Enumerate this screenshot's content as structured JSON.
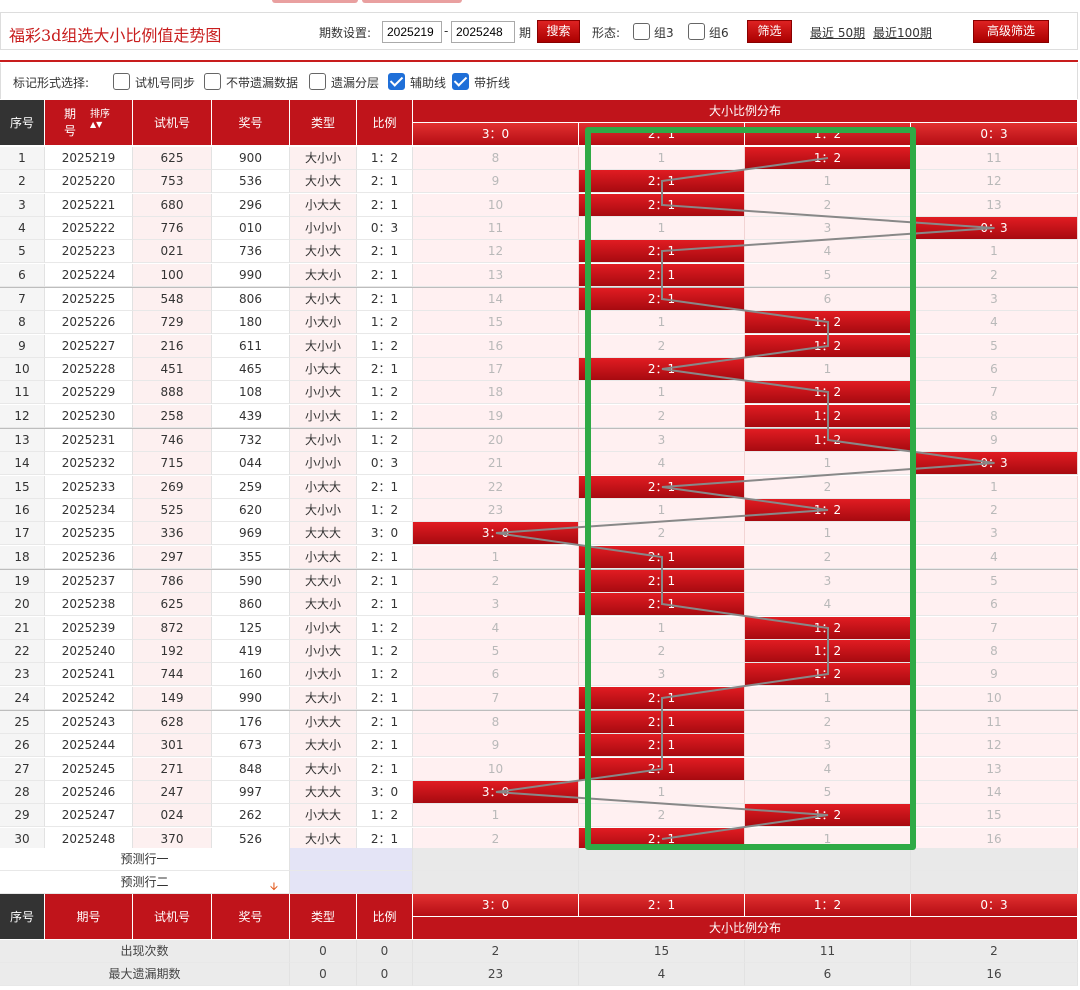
{
  "title": "福彩3d组选大小比例值走势图",
  "controls": {
    "period_label": "期数设置:",
    "from": "2025219",
    "to": "2025248",
    "period_suffix": "期",
    "search": "搜索",
    "form_label": "形态:",
    "zu3": "组3",
    "zu6": "组6",
    "filter": "筛选",
    "recent50": "最近 50期",
    "recent100": "最近100期",
    "advanced": "高级筛选"
  },
  "options": {
    "label": "标记形式选择:",
    "items": [
      {
        "label": "试机号同步",
        "checked": false
      },
      {
        "label": "不带遗漏数据",
        "checked": false
      },
      {
        "label": "遗漏分层",
        "checked": false
      },
      {
        "label": "辅助线",
        "checked": true
      },
      {
        "label": "带折线",
        "checked": true
      }
    ]
  },
  "headers": {
    "seq": "序号",
    "issue": "期号",
    "sort": "排序",
    "trial": "试机号",
    "draw": "奖号",
    "type": "类型",
    "ratio": "比例",
    "dist": "大小比例分布",
    "cols": [
      "3：0",
      "2：1",
      "1：2",
      "0：3"
    ]
  },
  "rows": [
    {
      "seq": "1",
      "issue": "2025219",
      "trial": "625",
      "draw": "900",
      "type": "大小小",
      "ratio": "1：2",
      "hit": 2,
      "vals": [
        "8",
        "1",
        "1：2",
        "11"
      ]
    },
    {
      "seq": "2",
      "issue": "2025220",
      "trial": "753",
      "draw": "536",
      "type": "大小大",
      "ratio": "2：1",
      "hit": 1,
      "vals": [
        "9",
        "2：1",
        "1",
        "12"
      ]
    },
    {
      "seq": "3",
      "issue": "2025221",
      "trial": "680",
      "draw": "296",
      "type": "小大大",
      "ratio": "2：1",
      "hit": 1,
      "vals": [
        "10",
        "2：1",
        "2",
        "13"
      ]
    },
    {
      "seq": "4",
      "issue": "2025222",
      "trial": "776",
      "draw": "010",
      "type": "小小小",
      "ratio": "0：3",
      "hit": 3,
      "vals": [
        "11",
        "1",
        "3",
        "0：3"
      ]
    },
    {
      "seq": "5",
      "issue": "2025223",
      "trial": "021",
      "draw": "736",
      "type": "大小大",
      "ratio": "2：1",
      "hit": 1,
      "vals": [
        "12",
        "2：1",
        "4",
        "1"
      ]
    },
    {
      "seq": "6",
      "issue": "2025224",
      "trial": "100",
      "draw": "990",
      "type": "大大小",
      "ratio": "2：1",
      "hit": 1,
      "vals": [
        "13",
        "2：1",
        "5",
        "2"
      ]
    },
    {
      "seq": "7",
      "issue": "2025225",
      "trial": "548",
      "draw": "806",
      "type": "大小大",
      "ratio": "2：1",
      "hit": 1,
      "vals": [
        "14",
        "2：1",
        "6",
        "3"
      ]
    },
    {
      "seq": "8",
      "issue": "2025226",
      "trial": "729",
      "draw": "180",
      "type": "小大小",
      "ratio": "1：2",
      "hit": 2,
      "vals": [
        "15",
        "1",
        "1：2",
        "4"
      ]
    },
    {
      "seq": "9",
      "issue": "2025227",
      "trial": "216",
      "draw": "611",
      "type": "大小小",
      "ratio": "1：2",
      "hit": 2,
      "vals": [
        "16",
        "2",
        "1：2",
        "5"
      ]
    },
    {
      "seq": "10",
      "issue": "2025228",
      "trial": "451",
      "draw": "465",
      "type": "小大大",
      "ratio": "2：1",
      "hit": 1,
      "vals": [
        "17",
        "2：1",
        "1",
        "6"
      ]
    },
    {
      "seq": "11",
      "issue": "2025229",
      "trial": "888",
      "draw": "108",
      "type": "小小大",
      "ratio": "1：2",
      "hit": 2,
      "vals": [
        "18",
        "1",
        "1：2",
        "7"
      ]
    },
    {
      "seq": "12",
      "issue": "2025230",
      "trial": "258",
      "draw": "439",
      "type": "小小大",
      "ratio": "1：2",
      "hit": 2,
      "vals": [
        "19",
        "2",
        "1：2",
        "8"
      ]
    },
    {
      "seq": "13",
      "issue": "2025231",
      "trial": "746",
      "draw": "732",
      "type": "大小小",
      "ratio": "1：2",
      "hit": 2,
      "vals": [
        "20",
        "3",
        "1：2",
        "9"
      ]
    },
    {
      "seq": "14",
      "issue": "2025232",
      "trial": "715",
      "draw": "044",
      "type": "小小小",
      "ratio": "0：3",
      "hit": 3,
      "vals": [
        "21",
        "4",
        "1",
        "0：3"
      ]
    },
    {
      "seq": "15",
      "issue": "2025233",
      "trial": "269",
      "draw": "259",
      "type": "小大大",
      "ratio": "2：1",
      "hit": 1,
      "vals": [
        "22",
        "2：1",
        "2",
        "1"
      ]
    },
    {
      "seq": "16",
      "issue": "2025234",
      "trial": "525",
      "draw": "620",
      "type": "大小小",
      "ratio": "1：2",
      "hit": 2,
      "vals": [
        "23",
        "1",
        "1：2",
        "2"
      ]
    },
    {
      "seq": "17",
      "issue": "2025235",
      "trial": "336",
      "draw": "969",
      "type": "大大大",
      "ratio": "3：0",
      "hit": 0,
      "vals": [
        "3：0",
        "2",
        "1",
        "3"
      ]
    },
    {
      "seq": "18",
      "issue": "2025236",
      "trial": "297",
      "draw": "355",
      "type": "小大大",
      "ratio": "2：1",
      "hit": 1,
      "vals": [
        "1",
        "2：1",
        "2",
        "4"
      ]
    },
    {
      "seq": "19",
      "issue": "2025237",
      "trial": "786",
      "draw": "590",
      "type": "大大小",
      "ratio": "2：1",
      "hit": 1,
      "vals": [
        "2",
        "2：1",
        "3",
        "5"
      ]
    },
    {
      "seq": "20",
      "issue": "2025238",
      "trial": "625",
      "draw": "860",
      "type": "大大小",
      "ratio": "2：1",
      "hit": 1,
      "vals": [
        "3",
        "2：1",
        "4",
        "6"
      ]
    },
    {
      "seq": "21",
      "issue": "2025239",
      "trial": "872",
      "draw": "125",
      "type": "小小大",
      "ratio": "1：2",
      "hit": 2,
      "vals": [
        "4",
        "1",
        "1：2",
        "7"
      ]
    },
    {
      "seq": "22",
      "issue": "2025240",
      "trial": "192",
      "draw": "419",
      "type": "小小大",
      "ratio": "1：2",
      "hit": 2,
      "vals": [
        "5",
        "2",
        "1：2",
        "8"
      ]
    },
    {
      "seq": "23",
      "issue": "2025241",
      "trial": "744",
      "draw": "160",
      "type": "小大小",
      "ratio": "1：2",
      "hit": 2,
      "vals": [
        "6",
        "3",
        "1：2",
        "9"
      ]
    },
    {
      "seq": "24",
      "issue": "2025242",
      "trial": "149",
      "draw": "990",
      "type": "大大小",
      "ratio": "2：1",
      "hit": 1,
      "vals": [
        "7",
        "2：1",
        "1",
        "10"
      ]
    },
    {
      "seq": "25",
      "issue": "2025243",
      "trial": "628",
      "draw": "176",
      "type": "小大大",
      "ratio": "2：1",
      "hit": 1,
      "vals": [
        "8",
        "2：1",
        "2",
        "11"
      ]
    },
    {
      "seq": "26",
      "issue": "2025244",
      "trial": "301",
      "draw": "673",
      "type": "大大小",
      "ratio": "2：1",
      "hit": 1,
      "vals": [
        "9",
        "2：1",
        "3",
        "12"
      ]
    },
    {
      "seq": "27",
      "issue": "2025245",
      "trial": "271",
      "draw": "848",
      "type": "大大小",
      "ratio": "2：1",
      "hit": 1,
      "vals": [
        "10",
        "2：1",
        "4",
        "13"
      ]
    },
    {
      "seq": "28",
      "issue": "2025246",
      "trial": "247",
      "draw": "997",
      "type": "大大大",
      "ratio": "3：0",
      "hit": 0,
      "vals": [
        "3：0",
        "1",
        "5",
        "14"
      ]
    },
    {
      "seq": "29",
      "issue": "2025247",
      "trial": "024",
      "draw": "262",
      "type": "小大大",
      "ratio": "1：2",
      "hit": 2,
      "vals": [
        "1",
        "2",
        "1：2",
        "15"
      ]
    },
    {
      "seq": "30",
      "issue": "2025248",
      "trial": "370",
      "draw": "526",
      "type": "大小大",
      "ratio": "2：1",
      "hit": 1,
      "vals": [
        "2",
        "2：1",
        "1",
        "16"
      ]
    }
  ],
  "predict": [
    "预测行一",
    "预测行二"
  ],
  "stats": [
    {
      "label": "出现次数",
      "type": "0",
      "ratio": "0",
      "vals": [
        "2",
        "15",
        "11",
        "2"
      ]
    },
    {
      "label": "最大遗漏期数",
      "type": "0",
      "ratio": "0",
      "vals": [
        "23",
        "4",
        "6",
        "16"
      ]
    }
  ],
  "colors": {
    "accent": "#c0141b",
    "highlight_box": "#2faa46",
    "trend_line": "#888888"
  }
}
